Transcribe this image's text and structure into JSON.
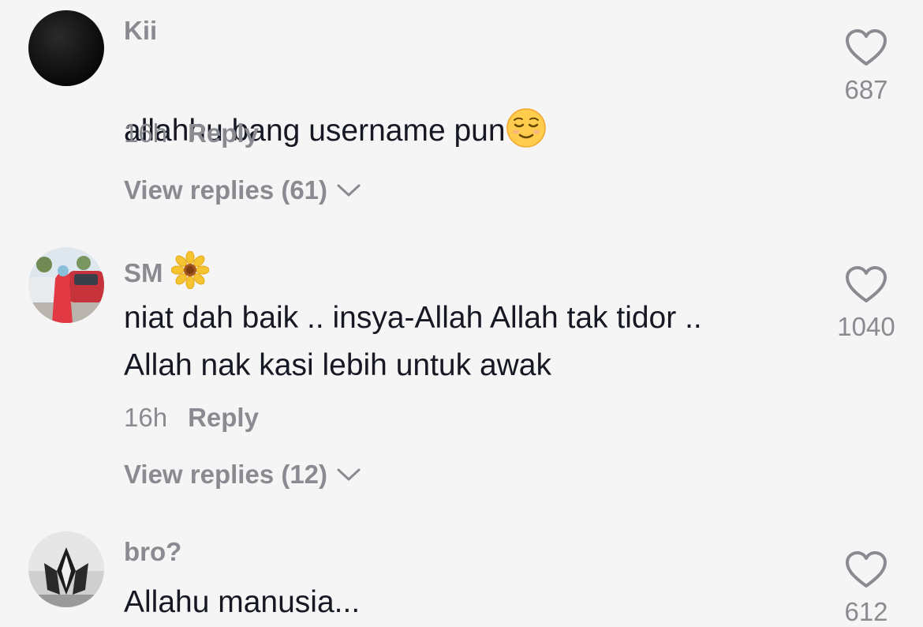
{
  "comments": [
    {
      "username": "Kii",
      "text": "allahhu bang username pun",
      "emoji": "relieved-face",
      "time": "16h",
      "reply_label": "Reply",
      "view_replies": "View replies (61)",
      "likes": "687",
      "avatar_color": "#111111"
    },
    {
      "username": "SM",
      "badge_emoji": "sunflower",
      "text": "niat dah baik .. insya-Allah Allah tak tidor ..\nAllah nak kasi lebih untuk awak",
      "time": "16h",
      "reply_label": "Reply",
      "view_replies": "View replies (12)",
      "likes": "1040"
    },
    {
      "username": "bro?",
      "text": "Allahu manusia...",
      "likes": "612"
    }
  ],
  "colors": {
    "background": "#f5f5f5",
    "primary_text": "#161823",
    "secondary_text": "#8a8b91"
  }
}
